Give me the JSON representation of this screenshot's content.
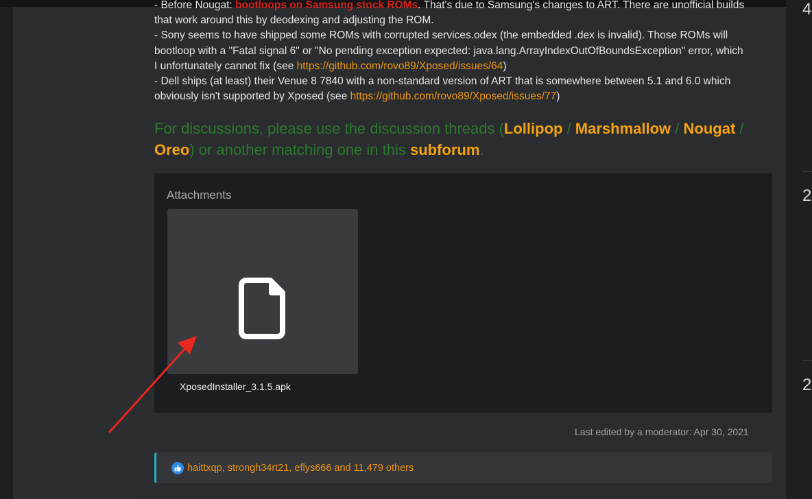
{
  "post": {
    "line0_a": "- Before Nougat: ",
    "line0_red": "bootloops on Samsung stock ROMs",
    "line0_b": ". That's due to Samsung's changes to ART. There are unofficial builds",
    "line1": "that work around this by deodexing and adjusting the ROM.",
    "line2": "- Sony seems to have shipped some ROMs with corrupted services.odex (the embedded .dex is invalid). Those ROMs will",
    "line3": "bootloop with a \"Fatal signal 6\" or \"No pending exception expected: java.lang.ArrayIndexOutOfBoundsException\" error, which",
    "line4_a": "I unfortunately cannot fix (see ",
    "line4_link": "https://github.com/rovo89/Xposed/issues/64",
    "line4_b": ")",
    "line5": "- Dell ships (at least) their Venue 8 7840 with a non-standard version of ART that is somewhere between 5.1 and 6.0 which",
    "line6_a": "obviously isn't supported by Xposed (see ",
    "line6_link": "https://github.com/rovo89/Xposed/issues/77",
    "line6_b": ")"
  },
  "discussion": {
    "intro": "For discussions, please use the discussion threads (",
    "lollipop": "Lollipop",
    "sep1": " / ",
    "marshmallow": "Marshmallow",
    "sep2": " / ",
    "nougat": "Nougat",
    "sep3": " / ",
    "oreo": "Oreo",
    "mid": ") or another matching one in this ",
    "subforum": "subforum",
    "end": "."
  },
  "attachments": {
    "title": "Attachments",
    "filename": "XposedInstaller_3.1.5.apk",
    "icon": "file-icon"
  },
  "edited": "Last edited by a moderator: Apr 30, 2021",
  "reactions": {
    "icon": "like-icon",
    "text": "haittxqp, strongh34rt21, eflys666 and 11,479 others"
  },
  "right_column": {
    "num1": "4",
    "num2": "2",
    "num3": "2"
  },
  "colors": {
    "link": "#f0960f",
    "warning_red": "#d6201a",
    "discussion_green": "#2b7a2b",
    "reaction_accent": "#20b3d4",
    "annotation_arrow": "#e8281e"
  }
}
